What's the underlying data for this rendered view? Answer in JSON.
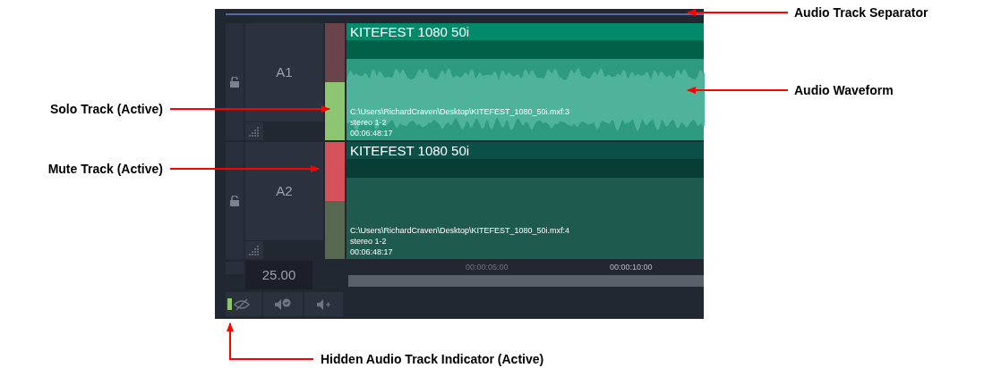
{
  "callouts": [
    {
      "kind": "right",
      "label": "Audio Track Separator"
    },
    {
      "kind": "right",
      "label": "Audio Waveform"
    },
    {
      "kind": "left",
      "label": "Solo Track (Active)"
    },
    {
      "kind": "left",
      "label": "Mute Track (Active)"
    },
    {
      "kind": "bottom",
      "label": "Hidden Audio Track Indicator (Active)"
    }
  ],
  "tracks": [
    {
      "name": "A1",
      "solo": true,
      "mute": false,
      "clip": {
        "title": "KITEFEST 1080 50i",
        "path": "C:\\Users\\RichardCraven\\Desktop\\KITEFEST_1080_50i.mxf:3",
        "channels": "stereo 1-2",
        "duration": "00:06:48:17"
      }
    },
    {
      "name": "A2",
      "solo": false,
      "mute": true,
      "clip": {
        "title": "KITEFEST 1080 50i",
        "path": "C:\\Users\\RichardCraven\\Desktop\\KITEFEST_1080_50i.mxf:4",
        "channels": "stereo 1-2",
        "duration": "00:06:48:17"
      }
    }
  ],
  "frame_rate": "25.00",
  "ruler": [
    "00:00:05:00",
    "00:00:10:00"
  ],
  "hidden_indicator": {
    "active": true
  }
}
